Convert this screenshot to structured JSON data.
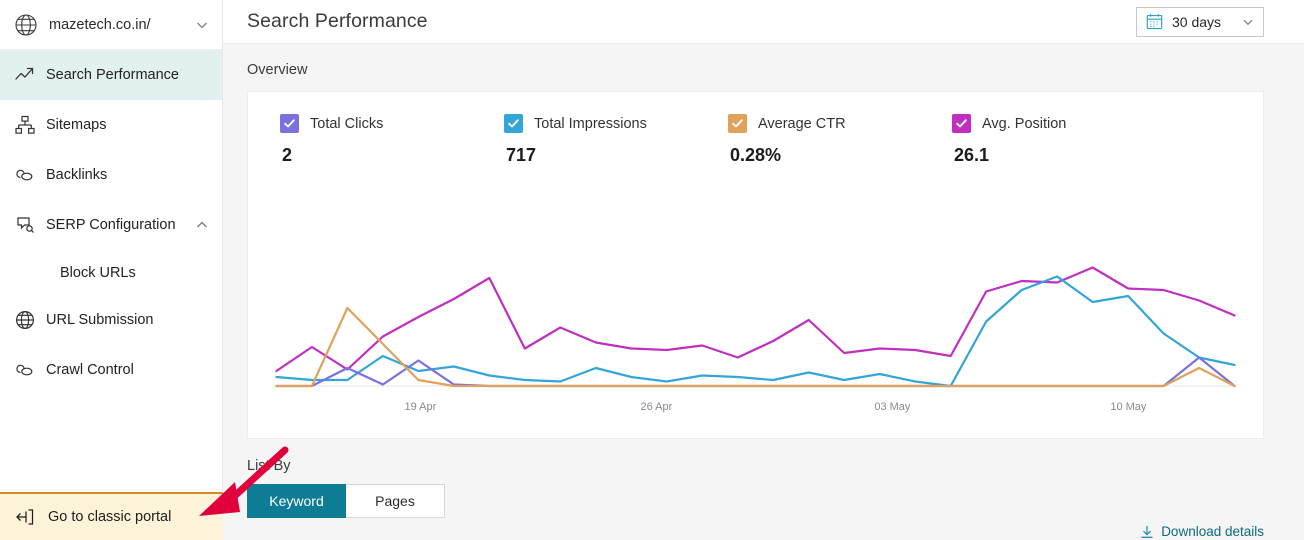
{
  "sidebar": {
    "site": {
      "name": "mazetech.co.in/",
      "icon": "globe-icon",
      "chevron": "chevron-down-icon"
    },
    "items": [
      {
        "label": "Search Performance",
        "icon": "trending-up-icon",
        "active": true
      },
      {
        "label": "Sitemaps",
        "icon": "sitemap-icon",
        "active": false
      },
      {
        "label": "Backlinks",
        "icon": "link-icon",
        "active": false
      },
      {
        "label": "SERP Configuration",
        "icon": "serp-icon",
        "active": false,
        "expandable": true,
        "chevron": "chevron-up-icon"
      },
      {
        "label": "Block URLs",
        "icon": "",
        "active": false,
        "sub": true
      },
      {
        "label": "URL Submission",
        "icon": "globe-icon",
        "active": false
      },
      {
        "label": "Crawl Control",
        "icon": "link-icon",
        "active": false
      }
    ],
    "classic_portal": {
      "label": "Go to classic portal",
      "icon": "exit-portal-icon"
    }
  },
  "header": {
    "title": "Search Performance",
    "date_picker": {
      "label": "30 days",
      "icon": "calendar-icon",
      "chevron": "chevron-down-icon"
    }
  },
  "overview": {
    "section_label": "Overview",
    "metrics": [
      {
        "name": "Total Clicks",
        "value": "2",
        "color": "#7a70e0",
        "checked": true
      },
      {
        "name": "Total Impressions",
        "value": "717",
        "color": "#33a5d8",
        "checked": true
      },
      {
        "name": "Average CTR",
        "value": "0.28%",
        "color": "#e0a25a",
        "checked": true
      },
      {
        "name": "Avg. Position",
        "value": "26.1",
        "color": "#c02fc0",
        "checked": true
      }
    ]
  },
  "list_by": {
    "label": "List By",
    "options": [
      {
        "label": "Keyword",
        "selected": true
      },
      {
        "label": "Pages",
        "selected": false
      }
    ],
    "download": {
      "label": "Download details",
      "icon": "download-icon"
    }
  },
  "colors": {
    "accent_teal": "#0d7c94",
    "active_nav_bg": "#e3f0f0",
    "classic_portal_bg": "#fdf3d9",
    "classic_portal_border": "#d08c20",
    "arrow": "#e0003c"
  },
  "chart_data": {
    "type": "line",
    "title": "",
    "xlabel": "",
    "ylabel": "",
    "grid": false,
    "legend": "top",
    "x_tick_labels": [
      "19 Apr",
      "26 Apr",
      "03 May",
      "10 May"
    ],
    "x_tick_positions": [
      0.145,
      0.395,
      0.645,
      0.895
    ],
    "ylim": [
      0,
      100
    ],
    "series": [
      {
        "name": "Avg. Position",
        "color": "#c02fc0",
        "values": [
          10,
          26,
          11,
          33,
          46,
          58,
          72,
          25,
          39,
          29,
          25,
          24,
          27,
          19,
          30,
          44,
          22,
          25,
          24,
          20,
          63,
          70,
          69,
          79,
          65,
          64,
          57,
          47
        ]
      },
      {
        "name": "Total Impressions",
        "color": "#33a5d8",
        "values": [
          6,
          4,
          4,
          20,
          10,
          13,
          7,
          4,
          3,
          12,
          6,
          3,
          7,
          6,
          4,
          9,
          4,
          8,
          3,
          0,
          43,
          64,
          73,
          56,
          60,
          35,
          19,
          14
        ]
      },
      {
        "name": "Total Clicks",
        "color": "#7a70e0",
        "values": [
          0,
          0,
          12,
          1,
          17,
          1,
          0,
          0,
          0,
          0,
          0,
          0,
          0,
          0,
          0,
          0,
          0,
          0,
          0,
          0,
          0,
          0,
          0,
          0,
          0,
          0,
          19,
          0
        ]
      },
      {
        "name": "Average CTR",
        "color": "#e0a25a",
        "values": [
          0,
          0,
          52,
          28,
          4,
          0,
          0,
          0,
          0,
          0,
          0,
          0,
          0,
          0,
          0,
          0,
          0,
          0,
          0,
          0,
          0,
          0,
          0,
          0,
          0,
          0,
          12,
          0
        ]
      }
    ]
  }
}
